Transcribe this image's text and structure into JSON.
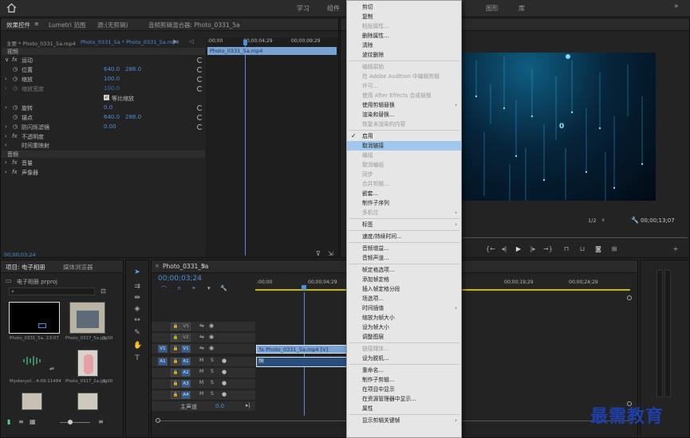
{
  "workspaces": [
    "学习",
    "组件",
    "图形",
    "库"
  ],
  "effect_controls": {
    "tabs": [
      "效果控件",
      "Lumetri 范围",
      "源:(无剪辑)",
      "音频剪辑混合器: Photo_0331_5a"
    ],
    "master": "主要 * Photo_0331_5a.mp4",
    "sequence_clip": "Photo_0331_5a * Photo_0331_5a.mp4",
    "ruler": [
      ":00;00",
      "00;00;04;29",
      "00;00;09;29"
    ],
    "clip_name": "Photo_0331_5a.mp4",
    "video_label": "视频",
    "motion": "运动",
    "position": {
      "label": "位置",
      "x": "640.0",
      "y": "288.0"
    },
    "scale": {
      "label": "缩放",
      "value": "100.0"
    },
    "scale_width": {
      "label": "缩放宽度",
      "value": "100.0"
    },
    "uniform": "等比缩放",
    "rotation": {
      "label": "旋转",
      "value": "0.0"
    },
    "anchor": {
      "label": "锚点",
      "x": "640.0",
      "y": "288.0"
    },
    "flicker": {
      "label": "防闪烁滤镜",
      "value": "0.00"
    },
    "opacity": "不透明度",
    "time_remap": "时间重映射",
    "audio_label": "音频",
    "volume": "音量",
    "panner": "声像器",
    "timecode": "00;00;03;24"
  },
  "program": {
    "zoom": "1/2",
    "timecode": "00;00;13;07",
    "glyph": "0"
  },
  "project": {
    "tabs": [
      "项目: 电子相册",
      "媒体浏览器"
    ],
    "file": "电子相册.prproj",
    "items": [
      {
        "name": "Photo_0331_5a...",
        "dur": "13:07"
      },
      {
        "name": "Photo_0317_5a.jpg",
        "dur": "5:00"
      },
      {
        "name": "Mysteryof...",
        "dur": "4:09:11484"
      },
      {
        "name": "Photo_0317_2a.jpg",
        "dur": "5:00"
      }
    ]
  },
  "timeline": {
    "tab": "Photo_0331_5a",
    "timecode": "00;00;03;24",
    "ruler": [
      ":00;00",
      "00;00;04;29",
      "00;00;19;29",
      "00;00;24;29"
    ],
    "video_tracks": [
      "V3",
      "V2",
      "V1"
    ],
    "audio_tracks": [
      "A1",
      "A2",
      "A3",
      "A4"
    ],
    "source_v": "V1",
    "source_a": "A1",
    "clip_video": "Photo_0331_5a.mp4 [V]",
    "clip_audio_icon": "fx",
    "master": "主声道",
    "master_val": "0.0"
  },
  "context_menu": {
    "items": [
      {
        "label": "剪切",
        "state": "normal"
      },
      {
        "label": "复制",
        "state": "normal"
      },
      {
        "label": "粘贴属性...",
        "state": "disabled"
      },
      {
        "label": "删除属性...",
        "state": "normal"
      },
      {
        "label": "清除",
        "state": "normal"
      },
      {
        "label": "波纹删除",
        "state": "normal"
      },
      {
        "sep": true
      },
      {
        "label": "编辑原始",
        "state": "disabled"
      },
      {
        "label": "在 Adobe Audition 中编辑剪辑",
        "state": "disabled"
      },
      {
        "label": "许可...",
        "state": "disabled"
      },
      {
        "label": "使用 After Effects 合成替换",
        "state": "disabled"
      },
      {
        "label": "使用剪辑替换",
        "state": "normal",
        "sub": true
      },
      {
        "label": "渲染和替换...",
        "state": "normal"
      },
      {
        "label": "恢复未渲染的内容",
        "state": "disabled"
      },
      {
        "sep": true
      },
      {
        "label": "启用",
        "state": "normal",
        "check": true
      },
      {
        "label": "取消链接",
        "state": "highlight"
      },
      {
        "label": "编组",
        "state": "disabled"
      },
      {
        "label": "取消编组",
        "state": "disabled"
      },
      {
        "label": "同步",
        "state": "disabled"
      },
      {
        "label": "合并剪辑...",
        "state": "disabled"
      },
      {
        "label": "嵌套...",
        "state": "normal"
      },
      {
        "label": "制作子序列",
        "state": "normal"
      },
      {
        "label": "多机位",
        "state": "disabled",
        "sub": true
      },
      {
        "sep": true
      },
      {
        "label": "标签",
        "state": "normal",
        "sub": true
      },
      {
        "sep": true
      },
      {
        "label": "速度/持续时间...",
        "state": "normal"
      },
      {
        "sep": true
      },
      {
        "label": "音频增益...",
        "state": "normal"
      },
      {
        "label": "音频声道...",
        "state": "normal"
      },
      {
        "sep": true
      },
      {
        "label": "帧定格选项...",
        "state": "normal"
      },
      {
        "label": "添加帧定格",
        "state": "normal"
      },
      {
        "label": "插入帧定格分段",
        "state": "normal"
      },
      {
        "label": "场选项...",
        "state": "normal"
      },
      {
        "label": "时间插值",
        "state": "normal",
        "sub": true
      },
      {
        "label": "缩放为帧大小",
        "state": "normal"
      },
      {
        "label": "设为帧大小",
        "state": "normal"
      },
      {
        "label": "调整图层",
        "state": "normal"
      },
      {
        "sep": true
      },
      {
        "label": "链接媒体...",
        "state": "disabled"
      },
      {
        "label": "设为脱机...",
        "state": "normal"
      },
      {
        "sep": true
      },
      {
        "label": "重命名...",
        "state": "normal"
      },
      {
        "label": "制作子剪辑...",
        "state": "normal"
      },
      {
        "label": "在项目中显示",
        "state": "normal"
      },
      {
        "label": "在资源管理器中显示...",
        "state": "normal"
      },
      {
        "label": "属性",
        "state": "normal"
      },
      {
        "sep": true
      },
      {
        "label": "显示剪辑关键帧",
        "state": "normal",
        "sub": true
      }
    ]
  },
  "watermark": "最需教育",
  "colors": {
    "accent": "#4f8ed9",
    "menu_highlight": "#9fc8ec",
    "clip": "#7aa1d4",
    "watermark": "#1f3fa8"
  }
}
